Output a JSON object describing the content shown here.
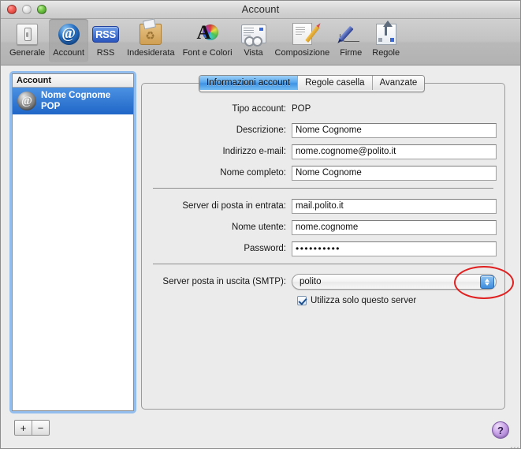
{
  "window": {
    "title": "Account",
    "traffic_lights": [
      "close",
      "minimize",
      "zoom"
    ]
  },
  "toolbar": {
    "items": [
      {
        "label": "Generale",
        "icon": "general-slider-icon",
        "selected": false
      },
      {
        "label": "Account",
        "icon": "at-sign-icon",
        "selected": true
      },
      {
        "label": "RSS",
        "icon": "rss-badge-icon",
        "selected": false
      },
      {
        "label": "Indesiderata",
        "icon": "junk-bag-icon",
        "selected": false
      },
      {
        "label": "Font e Colori",
        "icon": "font-color-wheel-icon",
        "selected": false
      },
      {
        "label": "Vista",
        "icon": "view-glasses-icon",
        "selected": false
      },
      {
        "label": "Composizione",
        "icon": "compose-pencil-icon",
        "selected": false
      },
      {
        "label": "Firme",
        "icon": "signature-pen-icon",
        "selected": false
      },
      {
        "label": "Regole",
        "icon": "rules-arrow-icon",
        "selected": false
      }
    ]
  },
  "sidebar": {
    "header": "Account",
    "accounts": [
      {
        "name": "Nome Cognome",
        "type": "POP",
        "icon": "account-at-icon",
        "selected": true
      }
    ],
    "add_label": "+",
    "remove_label": "−"
  },
  "tabs": [
    {
      "label": "Informazioni account",
      "active": true
    },
    {
      "label": "Regole casella",
      "active": false
    },
    {
      "label": "Avanzate",
      "active": false
    }
  ],
  "form": {
    "account_type": {
      "label": "Tipo account:",
      "value": "POP"
    },
    "description": {
      "label": "Descrizione:",
      "value": "Nome Cognome"
    },
    "email": {
      "label": "Indirizzo e-mail:",
      "value": "nome.cognome@polito.it"
    },
    "full_name": {
      "label": "Nome completo:",
      "value": "Nome Cognome"
    },
    "incoming_server": {
      "label": "Server di posta in entrata:",
      "value": "mail.polito.it"
    },
    "username": {
      "label": "Nome utente:",
      "value": "nome.cognome"
    },
    "password": {
      "label": "Password:",
      "value": "••••••••••"
    },
    "smtp": {
      "label": "Server posta in uscita (SMTP):",
      "value": "polito"
    },
    "use_only_this_server": {
      "label": "Utilizza solo questo server",
      "checked": true
    }
  },
  "annotation": {
    "shape": "ellipse",
    "color": "#e02020",
    "target": "smtp-popup-stepper"
  },
  "help": {
    "label": "?"
  }
}
